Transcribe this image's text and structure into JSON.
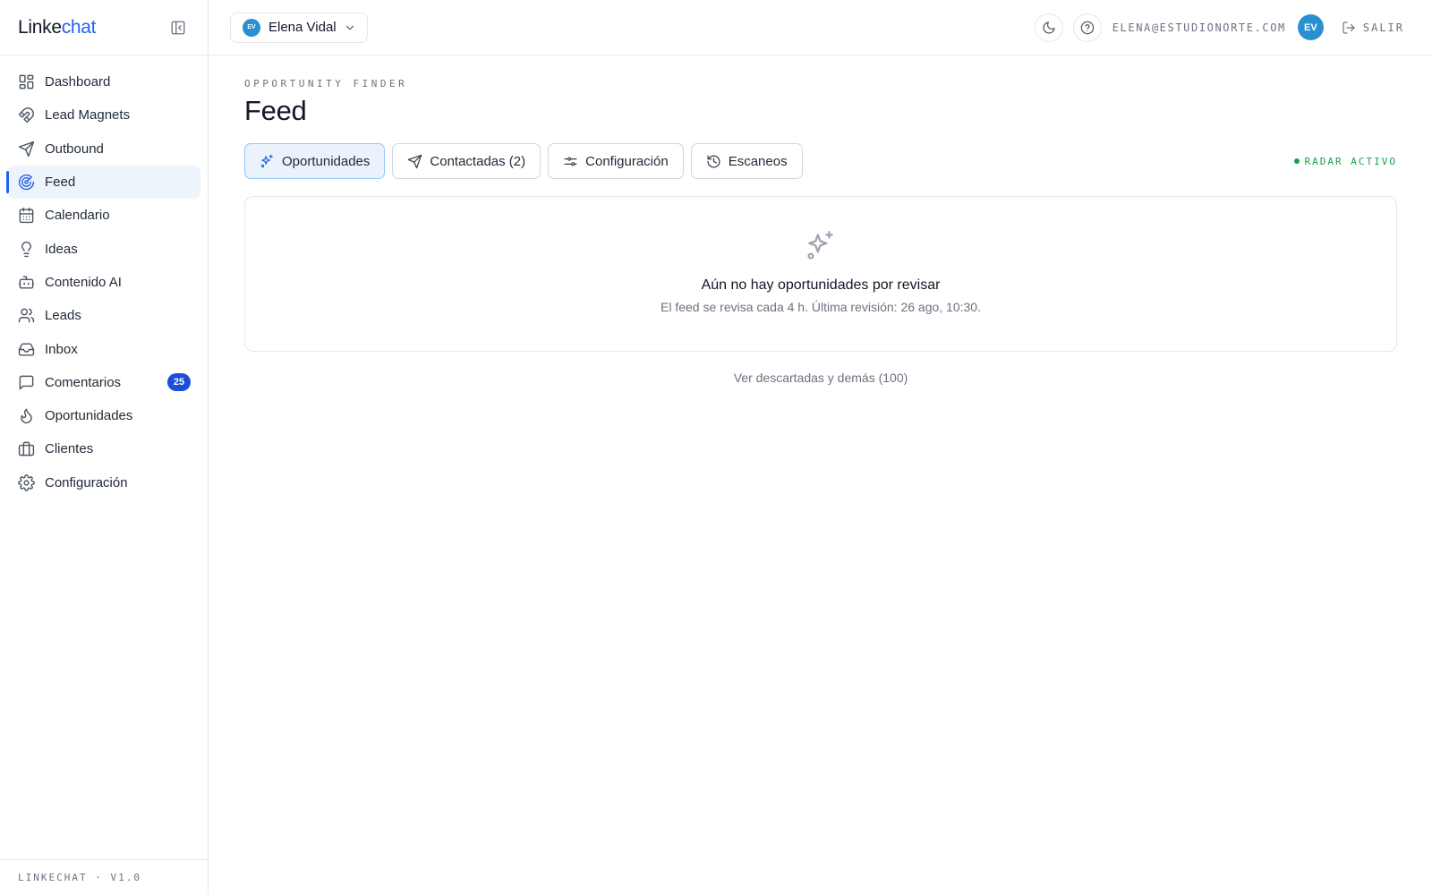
{
  "app": {
    "logo_part1": "Linke",
    "logo_part2": "chat",
    "version": "LINKECHAT · V1.0"
  },
  "sidebar": {
    "items": [
      {
        "label": "Dashboard",
        "icon": "dashboard-icon"
      },
      {
        "label": "Lead Magnets",
        "icon": "magnet-icon"
      },
      {
        "label": "Outbound",
        "icon": "send-icon"
      },
      {
        "label": "Feed",
        "icon": "radar-icon",
        "active": true
      },
      {
        "label": "Calendario",
        "icon": "calendar-icon"
      },
      {
        "label": "Ideas",
        "icon": "lightbulb-icon"
      },
      {
        "label": "Contenido AI",
        "icon": "bot-icon"
      },
      {
        "label": "Leads",
        "icon": "users-icon"
      },
      {
        "label": "Inbox",
        "icon": "inbox-icon"
      },
      {
        "label": "Comentarios",
        "icon": "comment-icon",
        "badge": "25"
      },
      {
        "label": "Oportunidades",
        "icon": "flame-icon"
      },
      {
        "label": "Clientes",
        "icon": "briefcase-icon"
      },
      {
        "label": "Configuración",
        "icon": "gear-icon"
      }
    ]
  },
  "topbar": {
    "account_initials": "EV",
    "account_name": "Elena Vidal",
    "email": "ELENA@ESTUDIONORTE.COM",
    "avatar_initials": "EV",
    "logout_label": "SALIR"
  },
  "page": {
    "eyebrow": "OPPORTUNITY FINDER",
    "title": "Feed",
    "tabs": [
      {
        "label": "Oportunidades",
        "icon": "sparkles-icon",
        "active": true
      },
      {
        "label": "Contactadas (2)",
        "icon": "send-icon"
      },
      {
        "label": "Configuración",
        "icon": "sliders-icon"
      },
      {
        "label": "Escaneos",
        "icon": "history-icon"
      }
    ],
    "status": "RADAR ACTIVO",
    "empty_title": "Aún no hay oportunidades por revisar",
    "empty_subtitle": "El feed se revisa cada 4 h. Última revisión: 26 ago, 10:30.",
    "more_link": "Ver descartadas y demás (100)"
  },
  "colors": {
    "accent": "#2563eb",
    "status_green": "#16a34a",
    "avatar": "#2b8fd4"
  }
}
